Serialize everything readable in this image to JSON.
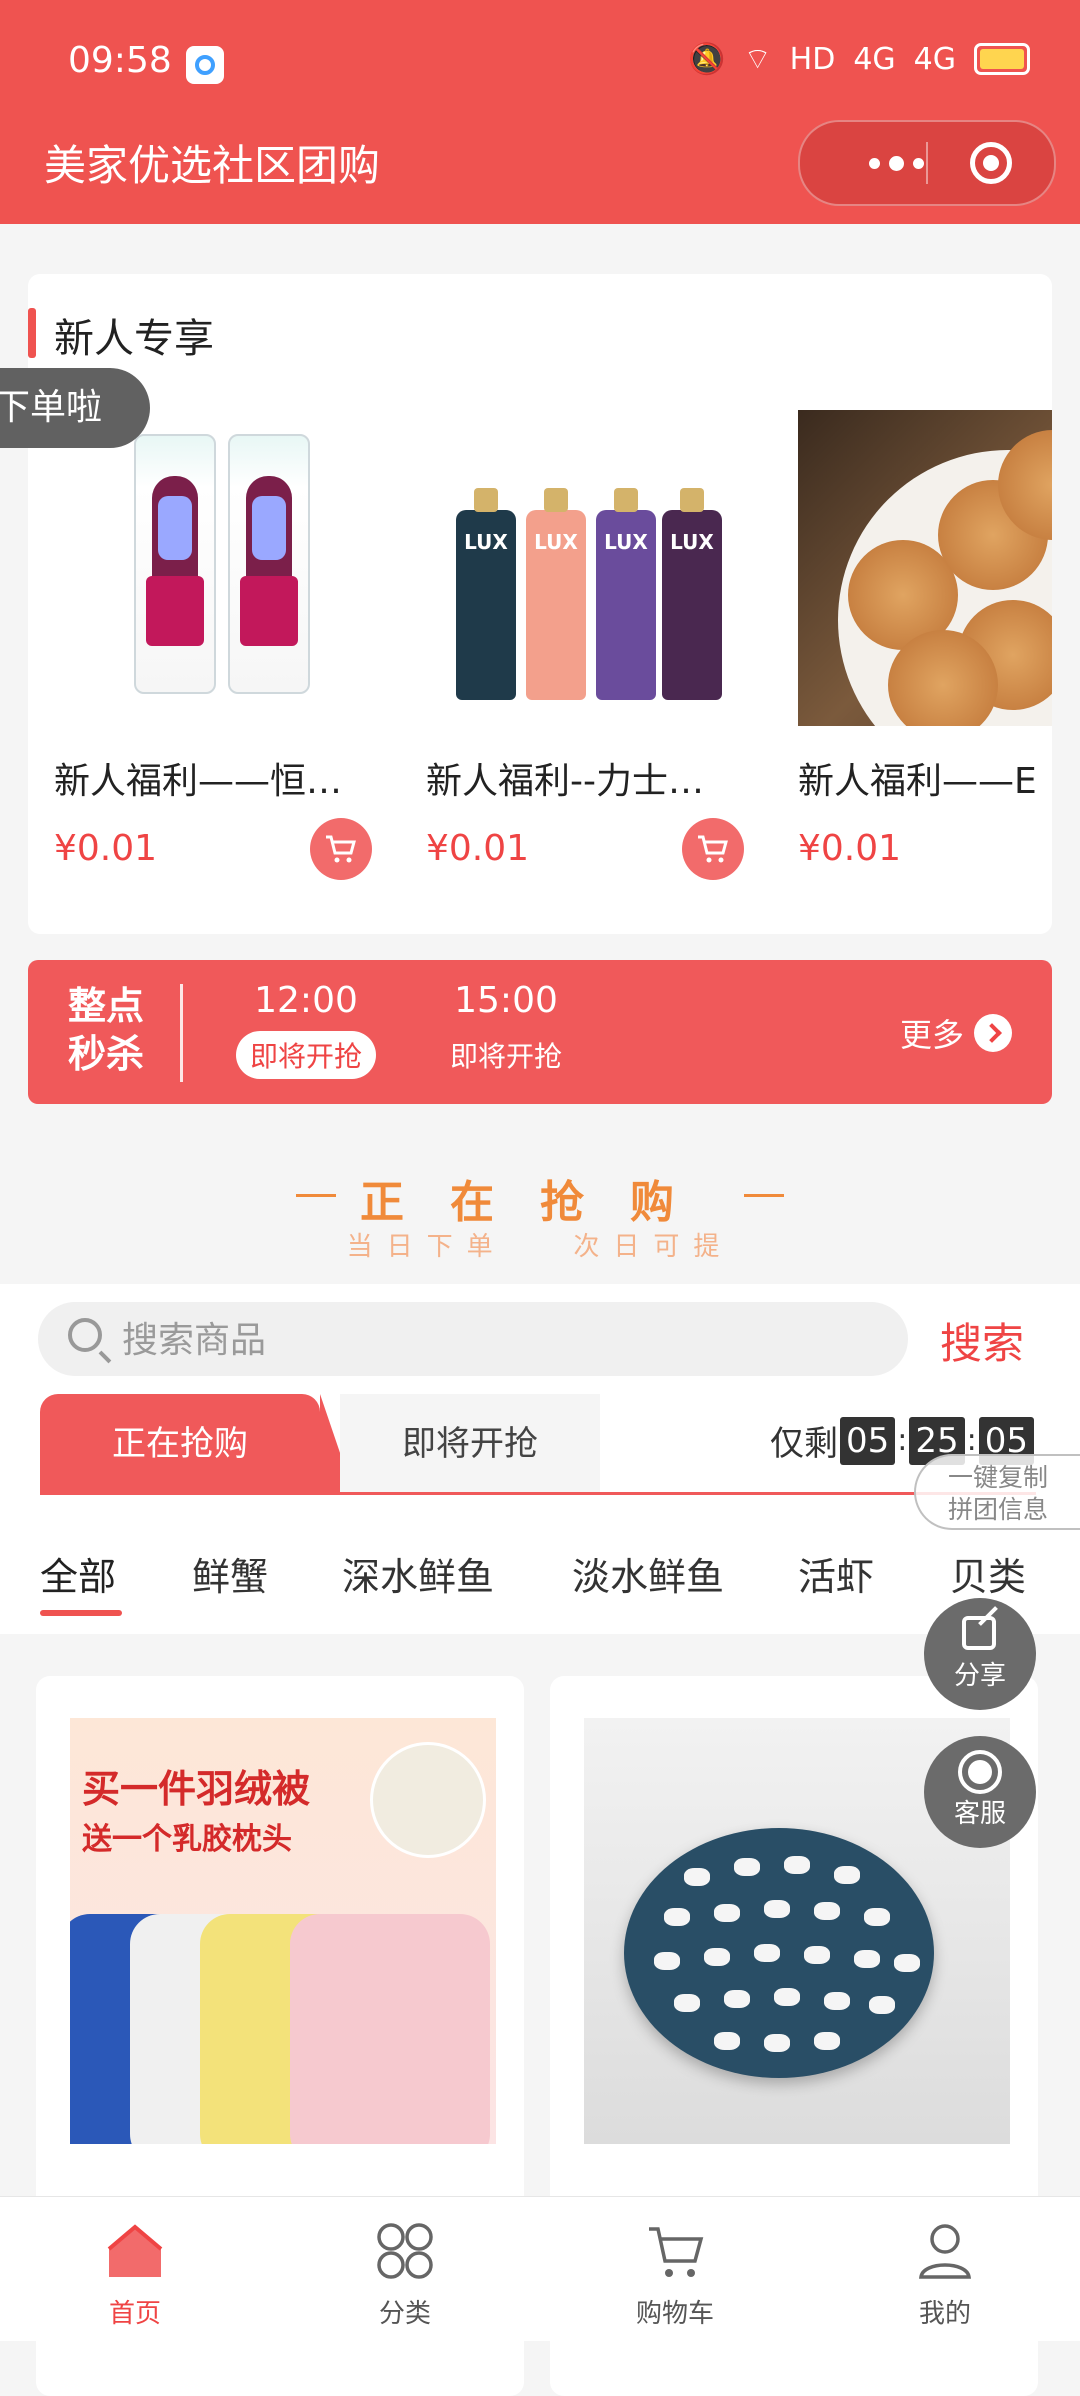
{
  "status": {
    "time": "09:58",
    "network": "HD",
    "signal1": "4G",
    "signal2": "4G"
  },
  "app": {
    "title": "美家优选社区团购"
  },
  "newcomer": {
    "section_title": "新人专享",
    "bubble": "下单啦",
    "products": [
      {
        "name": "新人福利——恒…",
        "price": "¥0.01"
      },
      {
        "name": "新人福利--力士…",
        "price": "¥0.01"
      },
      {
        "name": "新人福利——E",
        "price": "¥0.01"
      }
    ]
  },
  "seckill": {
    "title_line1": "整点",
    "title_line2": "秒杀",
    "slots": [
      {
        "time": "12:00",
        "status": "即将开抢",
        "active": true
      },
      {
        "time": "15:00",
        "status": "即将开抢",
        "active": false
      }
    ],
    "more": "更多"
  },
  "hot": {
    "main": "正在抢购",
    "sub1": "当日下单",
    "sub2": "次日可提"
  },
  "search": {
    "placeholder": "搜索商品",
    "button": "搜索"
  },
  "tabs": {
    "active": "正在抢购",
    "next": "即将开抢"
  },
  "countdown": {
    "prefix": "仅剩",
    "h": "05",
    "m": "25",
    "s": "05"
  },
  "copy_button": {
    "line1": "一键复制",
    "line2": "拼团信息"
  },
  "categories": [
    "全部",
    "鲜蟹",
    "深水鲜鱼",
    "淡水鲜鱼",
    "活虾",
    "贝类"
  ],
  "float": {
    "share": "分享",
    "service": "客服"
  },
  "goods": [
    {
      "img_text1": "买一件羽绒被",
      "img_text2": "送一个乳胶枕头"
    },
    {}
  ],
  "bottom_nav": [
    {
      "label": "首页",
      "icon": "home-icon",
      "active": true
    },
    {
      "label": "分类",
      "icon": "category-icon",
      "active": false
    },
    {
      "label": "购物车",
      "icon": "cart-icon",
      "active": false
    },
    {
      "label": "我的",
      "icon": "user-icon",
      "active": false
    }
  ],
  "colors": {
    "brand": "#ef5350",
    "price": "#ef4444",
    "accent_orange": "#f08a3a"
  }
}
